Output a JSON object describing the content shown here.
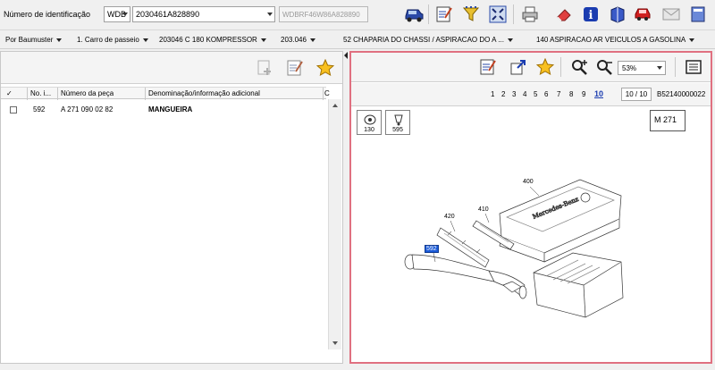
{
  "topbar": {
    "id_label": "Número de identificação",
    "prefix_value": "WDB",
    "chassis_value": "2030461A828890",
    "vin_full": "WDBRF46W86A828890"
  },
  "breadcrumb": [
    {
      "label": "Por Baumuster"
    },
    {
      "label": "1. Carro de passeio"
    },
    {
      "label": "203046 C 180 KOMPRESSOR"
    },
    {
      "label": "203.046"
    },
    {
      "label": "52 CHAPARIA DO CHASSI / ASPIRACAO DO A ..."
    },
    {
      "label": "140 ASPIRACAO AR VEICULOS A GASOLINA"
    }
  ],
  "table": {
    "headers": [
      "✓",
      "No. i...",
      "Número da peça",
      "Denominação/informação adicional",
      "C"
    ],
    "rows": [
      {
        "no": "592",
        "part_number": "A 271 090 02 82",
        "description": "MANGUEIRA"
      }
    ]
  },
  "viewer": {
    "zoom": "53%",
    "pages": [
      "1",
      "2",
      "3",
      "4",
      "5",
      "6",
      "7",
      "8",
      "9"
    ],
    "active_page": "10",
    "page_counter": "10 / 10",
    "drawing_id": "B52140000022",
    "ref_boxes": [
      "130",
      "595"
    ],
    "model": "M 271",
    "callouts": {
      "c400": "400",
      "c420": "420",
      "c410": "410",
      "c592": "592"
    },
    "brand_text": "Mercedes-Benz"
  },
  "colors": {
    "accent_border": "#e07080",
    "highlight": "#1a5ad8"
  }
}
